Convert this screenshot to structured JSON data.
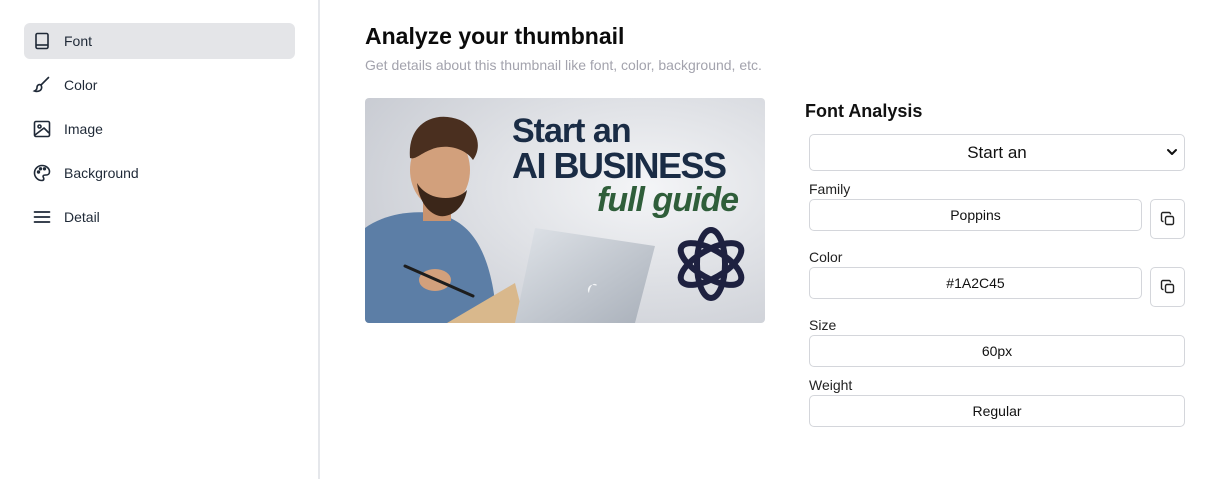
{
  "sidebar": {
    "items": [
      {
        "label": "Font",
        "icon": "book-icon",
        "active": true
      },
      {
        "label": "Color",
        "icon": "paintbrush-icon",
        "active": false
      },
      {
        "label": "Image",
        "icon": "image-icon",
        "active": false
      },
      {
        "label": "Background",
        "icon": "palette-icon",
        "active": false
      },
      {
        "label": "Detail",
        "icon": "menu-lines-icon",
        "active": false
      }
    ]
  },
  "main": {
    "title": "Analyze your thumbnail",
    "subtitle": "Get details about this thumbnail like font, color, background, etc."
  },
  "thumbnail": {
    "line1": "Start an",
    "line2": "AI BUSINESS",
    "line3": "full guide",
    "text_color": "#1A2C45",
    "accent_color": "#2f5e3a"
  },
  "font_analysis": {
    "title": "Font Analysis",
    "selected_text": "Start an",
    "fields": {
      "family_label": "Family",
      "family_value": "Poppins",
      "color_label": "Color",
      "color_value": "#1A2C45",
      "size_label": "Size",
      "size_value": "60px",
      "weight_label": "Weight",
      "weight_value": "Regular"
    }
  },
  "colors": {
    "active_nav_bg": "#e4e5e8",
    "border": "#d4d6db",
    "subtitle": "#a3a3ad"
  }
}
